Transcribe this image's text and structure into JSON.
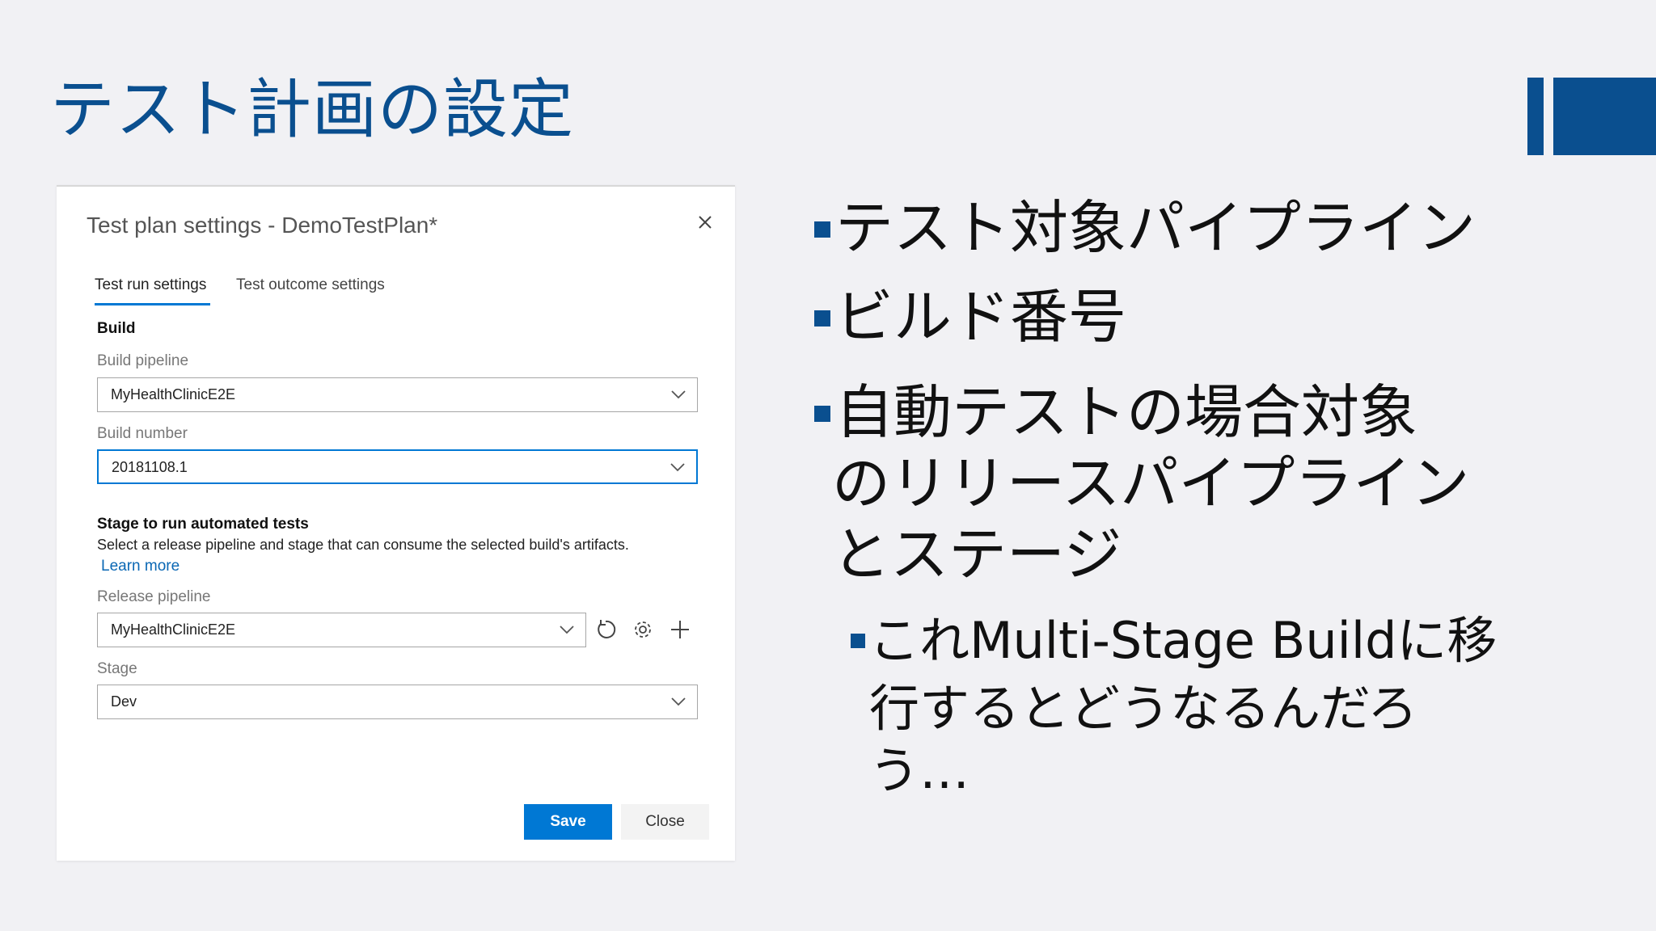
{
  "slide": {
    "title": "テスト計画の設定",
    "bullets": [
      {
        "lines": [
          "テスト対象パイプライン"
        ]
      },
      {
        "lines": [
          "ビルド番号"
        ]
      },
      {
        "lines": [
          "自動テストの場合対象",
          "のリリースパイプライン",
          "とステージ"
        ]
      }
    ],
    "sub_bullet": {
      "lines": [
        "これMulti-Stage Buildに移",
        "行するとどうなるんだろ",
        "う…"
      ]
    },
    "accent_color": "#0a4f8f"
  },
  "dialog": {
    "title": "Test plan settings - DemoTestPlan*",
    "close_icon": "close-icon",
    "tabs": [
      {
        "label": "Test run settings",
        "active": true
      },
      {
        "label": "Test outcome settings",
        "active": false
      }
    ],
    "build_section": {
      "heading": "Build",
      "pipeline_label": "Build pipeline",
      "pipeline_value": "MyHealthClinicE2E",
      "number_label": "Build number",
      "number_value": "20181108.1"
    },
    "stage_section": {
      "heading": "Stage to run automated tests",
      "description": "Select a release pipeline and stage that can consume the selected build's artifacts.",
      "learn_more": "Learn more",
      "release_label": "Release pipeline",
      "release_value": "MyHealthClinicE2E",
      "stage_label": "Stage",
      "stage_value": "Dev",
      "icons": [
        "refresh-icon",
        "gear-icon",
        "plus-icon"
      ]
    },
    "buttons": {
      "save": "Save",
      "close": "Close"
    },
    "accent_color": "#0078d4"
  }
}
